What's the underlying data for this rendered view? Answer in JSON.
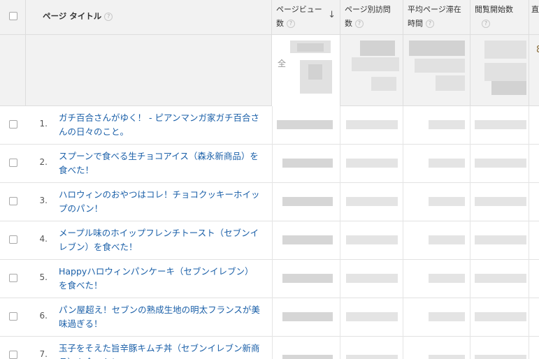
{
  "header": {
    "page_title": "ページ タイトル",
    "pageviews_line1": "ページビュー",
    "pageviews_line2": "数",
    "unique_line1": "ページ別訪問",
    "unique_line2": "数",
    "avgtime_line1": "平均ページ滞在",
    "avgtime_line2": "時間",
    "entrances": "閲覧開始数",
    "next_col_partial": "直",
    "help": "?",
    "sort": "↓"
  },
  "totals": {
    "partial_label": "全",
    "partial_digit": "8"
  },
  "rows": [
    {
      "index": "1.",
      "title": "ガチ百合さんがゆく！ - ピアンマンガ家ガチ百合さんの日々のこと。"
    },
    {
      "index": "2.",
      "title": "スプーンで食べる生チョコアイス（森永新商品）を食べた！"
    },
    {
      "index": "3.",
      "title": "ハロウィンのおやつはコレ！チョコクッキーホイップのパン！"
    },
    {
      "index": "4.",
      "title": "メープル味のホイップフレンチトースト（セブンイレブン）を食べた！"
    },
    {
      "index": "5.",
      "title": "Happyハロウィンパンケーキ（セブンイレブン）を食べた！"
    },
    {
      "index": "6.",
      "title": "パン屋超え！セブンの熟成生地の明太フランスが美味過ぎる！"
    },
    {
      "index": "7.",
      "title": "玉子をそえた旨辛豚キムチ丼（セブンイレブン新商品）を食べた！"
    }
  ]
}
